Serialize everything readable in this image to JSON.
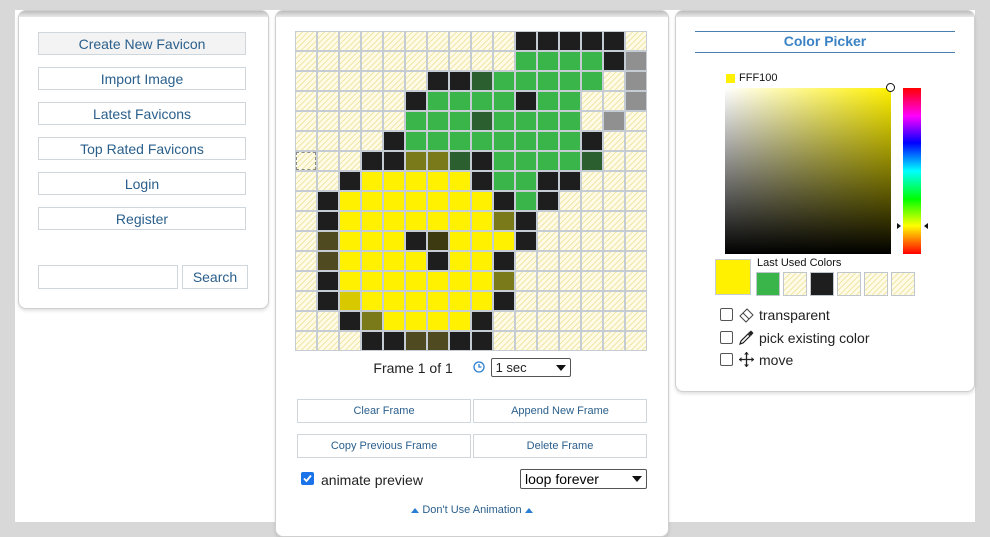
{
  "nav": {
    "items": [
      {
        "label": "Create New Favicon"
      },
      {
        "label": "Import Image"
      },
      {
        "label": "Latest Favicons"
      },
      {
        "label": "Top Rated Favicons"
      },
      {
        "label": "Login"
      },
      {
        "label": "Register"
      }
    ],
    "search_placeholder": "",
    "search_button": "Search"
  },
  "editor": {
    "palette": {
      "t": "transparent",
      "Y": "#FFF100",
      "G": "#3ab54a",
      "K": "#1e1e1e",
      "D": "#2b5f30",
      "O": "#7a7a1a",
      "S": "#3d3a12",
      "M": "#504a20",
      "L": "#d8c800",
      "A": "#909090"
    },
    "grid": [
      "ttttttttttKKKKKt",
      "ttttttttttGGGGKA",
      "ttttttKKDGGGGGtA",
      "tttttKGGGGKGGttA",
      "tttttGGGDGGGGtAt",
      "ttttKGGGGGGGGKtt",
      "tttKKOODKGGGGDtt",
      "ttKYYYYYKGGKKttt",
      "tKYYYYYYYKGKtttt",
      "tKYYYYYYYOKttttt",
      "tMYYYKSYYYKttttt",
      "tMYYYYKYYKtttttt",
      "tKYYYYYYYOtttttt",
      "tKLYYYYYYKtttttt",
      "ttKOYYYYKttttttt",
      "tttKKMMKKttttttt"
    ],
    "frame_label": "Frame 1 of 1",
    "speed": "1 sec",
    "buttons": {
      "clear": "Clear Frame",
      "append": "Append New Frame",
      "copy_prev": "Copy Previous Frame",
      "delete": "Delete Frame"
    },
    "animate_preview_label": "animate preview",
    "animate_preview_checked": true,
    "loop": "loop forever",
    "no_animation_link": "Don't Use Animation"
  },
  "color_picker": {
    "title": "Color Picker",
    "hex": "FFF100",
    "current_color": "#FFF100",
    "last_used_label": "Last Used Colors",
    "last_used": [
      "#3ab54a",
      "transparent",
      "#1e1e1e",
      "transparent",
      "transparent",
      "transparent"
    ],
    "options": [
      {
        "label": "transparent",
        "icon": "eraser-icon"
      },
      {
        "label": "pick existing color",
        "icon": "eyedropper-icon"
      },
      {
        "label": "move",
        "icon": "move-icon"
      }
    ]
  }
}
